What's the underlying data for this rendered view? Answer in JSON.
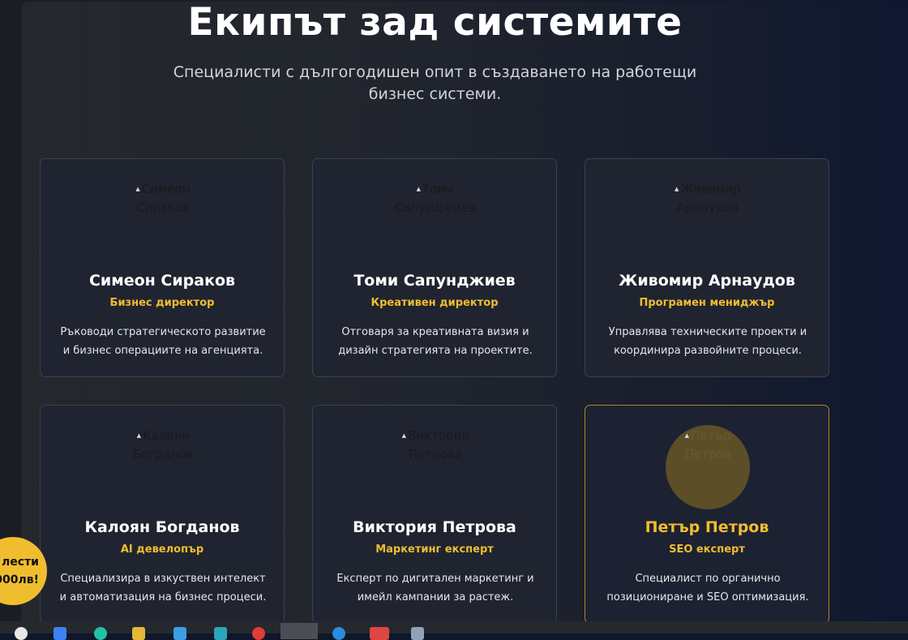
{
  "section": {
    "title": "Екипът зад системите",
    "subtitle": "Специалисти с дългогодишен опит в създаването на работещи бизнес системи."
  },
  "team": [
    {
      "photo_alt": "Симеон Сираков",
      "name": "Симеон Сираков",
      "role": "Бизнес директор",
      "description": "Ръководи стратегическото развитие и бизнес операциите на агенцията."
    },
    {
      "photo_alt": "Томи Сапунджиев",
      "name": "Томи Сапунджиев",
      "role": "Креативен директор",
      "description": "Отговаря за креативната визия и дизайн стратегията на проектите."
    },
    {
      "photo_alt": "Живомир Арнаудов",
      "name": "Живомир Арнаудов",
      "role": "Програмен мениджър",
      "description": "Управлява техническите проекти и координира развойните процеси."
    },
    {
      "photo_alt": "Калоян Богданов",
      "name": "Калоян Богданов",
      "role": "AI девелопър",
      "description": "Специализира в изкуствен интелект и автоматизация на бизнес процеси."
    },
    {
      "photo_alt": "Виктория Петрова",
      "name": "Виктория Петрова",
      "role": "Маркетинг експерт",
      "description": "Експерт по дигитален маркетинг и имейл кампании за растеж."
    },
    {
      "photo_alt": "Петър Петров",
      "name": "Петър Петров",
      "role": "SEO експерт",
      "description": "Специалист по органично позициониране и SEO оптимизация."
    }
  ],
  "promo_badge": {
    "line1": "лести",
    "line2": "000лв!"
  },
  "colors": {
    "accent": "#f0bd2f",
    "card_bg": "#1f2430",
    "card_border": "#3b4150"
  },
  "taskbar_icons": [
    "chrome-icon",
    "files-icon",
    "edge-icon",
    "explorer-icon",
    "store-icon",
    "app-icon",
    "opera-icon",
    "active-app-icon",
    "browser-icon",
    "app-red-icon",
    "app-gray-icon"
  ]
}
